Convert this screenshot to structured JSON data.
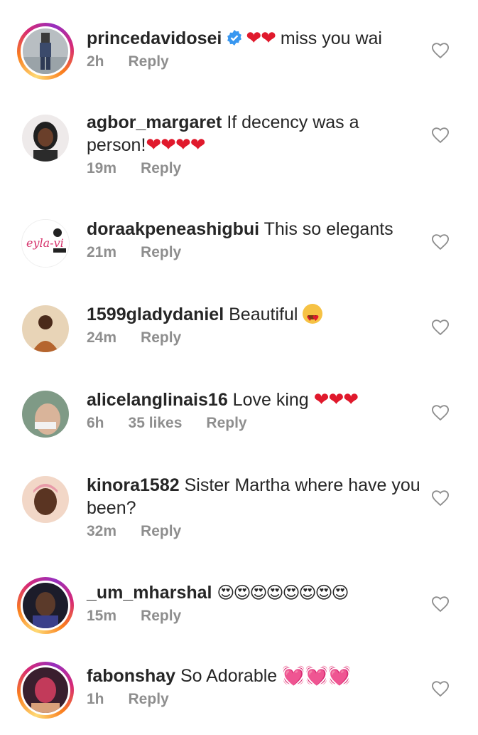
{
  "comments": [
    {
      "username": "princedavidosei",
      "verified": true,
      "text": "",
      "emoji": "❤❤",
      "after_text": "miss you wai",
      "time": "2h",
      "likes": "",
      "reply": "Reply",
      "avatar_colors": [
        "#9aa3a8",
        "#3b4a6b"
      ],
      "story": true
    },
    {
      "username": "agbor_margaret",
      "verified": false,
      "text": "If decency was a person!",
      "emoji": "❤❤❤❤",
      "after_text": "",
      "time": "19m",
      "likes": "",
      "reply": "Reply",
      "avatar_colors": [
        "#f1ece9",
        "#2b2b2b"
      ],
      "story": false
    },
    {
      "username": "doraakpeneashigbui",
      "verified": false,
      "text": "This so elegants",
      "emoji": "",
      "after_text": "",
      "time": "21m",
      "likes": "",
      "reply": "Reply",
      "avatar_label": "eyla-vi",
      "avatar_colors": [
        "#ffffff",
        "#d6336c"
      ],
      "story": false
    },
    {
      "username": "1599gladydaniel",
      "verified": false,
      "text": "Beautiful",
      "emoji": "face",
      "after_text": "",
      "time": "24m",
      "likes": "",
      "reply": "Reply",
      "avatar_colors": [
        "#e8d4b7",
        "#7a4a2a"
      ],
      "story": false
    },
    {
      "username": "alicelanglinais16",
      "verified": false,
      "text": "Love king",
      "emoji": "❤❤❤",
      "after_text": "",
      "time": "6h",
      "likes": "35 likes",
      "reply": "Reply",
      "avatar_colors": [
        "#9fb3a2",
        "#d9b49a"
      ],
      "story": false
    },
    {
      "username": "kinora1582",
      "verified": false,
      "text": "Sister Martha where have you been?",
      "emoji": "",
      "after_text": "",
      "time": "32m",
      "likes": "",
      "reply": "Reply",
      "avatar_colors": [
        "#f2d7c7",
        "#5a3422"
      ],
      "story": false
    },
    {
      "username": "_um_mharshal",
      "verified": false,
      "text": "",
      "emoji": "😍😍😍😍😍😍😍😍",
      "after_text": "",
      "time": "15m",
      "likes": "",
      "reply": "Reply",
      "avatar_colors": [
        "#1c1c2a",
        "#5b3a8a"
      ],
      "story": true
    },
    {
      "username": "fabonshay",
      "verified": false,
      "text": "So Adorable",
      "emoji": "💓💓💓",
      "after_text": "",
      "time": "1h",
      "likes": "",
      "reply": "Reply",
      "avatar_colors": [
        "#3a1f2e",
        "#c23a5a"
      ],
      "story": true
    }
  ]
}
